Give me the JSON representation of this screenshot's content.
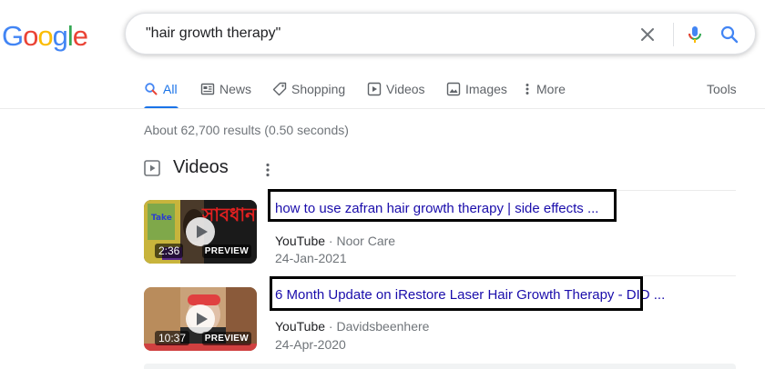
{
  "logo": {
    "letters": [
      "G",
      "o",
      "o",
      "g",
      "l",
      "e"
    ],
    "colors": [
      "#4285f4",
      "#ea4335",
      "#fbbc05",
      "#4285f4",
      "#34a853",
      "#ea4335"
    ]
  },
  "search": {
    "query": "\"hair growth therapy\""
  },
  "tabs": [
    {
      "label": "All",
      "icon": "search-icon",
      "active": true
    },
    {
      "label": "News",
      "icon": "news-icon"
    },
    {
      "label": "Shopping",
      "icon": "tag-icon"
    },
    {
      "label": "Videos",
      "icon": "play-icon"
    },
    {
      "label": "Images",
      "icon": "image-icon"
    },
    {
      "label": "More",
      "icon": "more-vert-icon"
    }
  ],
  "tools_label": "Tools",
  "result_stats": "About 62,700 results (0.50 seconds)",
  "videos": {
    "heading": "Videos",
    "items": [
      {
        "title": "how to use zafran hair growth therapy | side effects ...",
        "source": "YouTube",
        "separator": "·",
        "channel": "Noor Care",
        "date": "24-Jan-2021",
        "duration": "2:36",
        "preview_label": "PREVIEW",
        "thumb_text": "সাবধান"
      },
      {
        "title": "6 Month Update on iRestore Laser Hair Growth Therapy - DID ...",
        "source": "YouTube",
        "separator": "·",
        "channel": "Davidsbeenhere",
        "date": "24-Apr-2020",
        "duration": "10:37",
        "preview_label": "PREVIEW"
      }
    ]
  },
  "colors": {
    "link": "#1a0dab",
    "accent": "#1a73e8",
    "muted": "#70757a"
  }
}
